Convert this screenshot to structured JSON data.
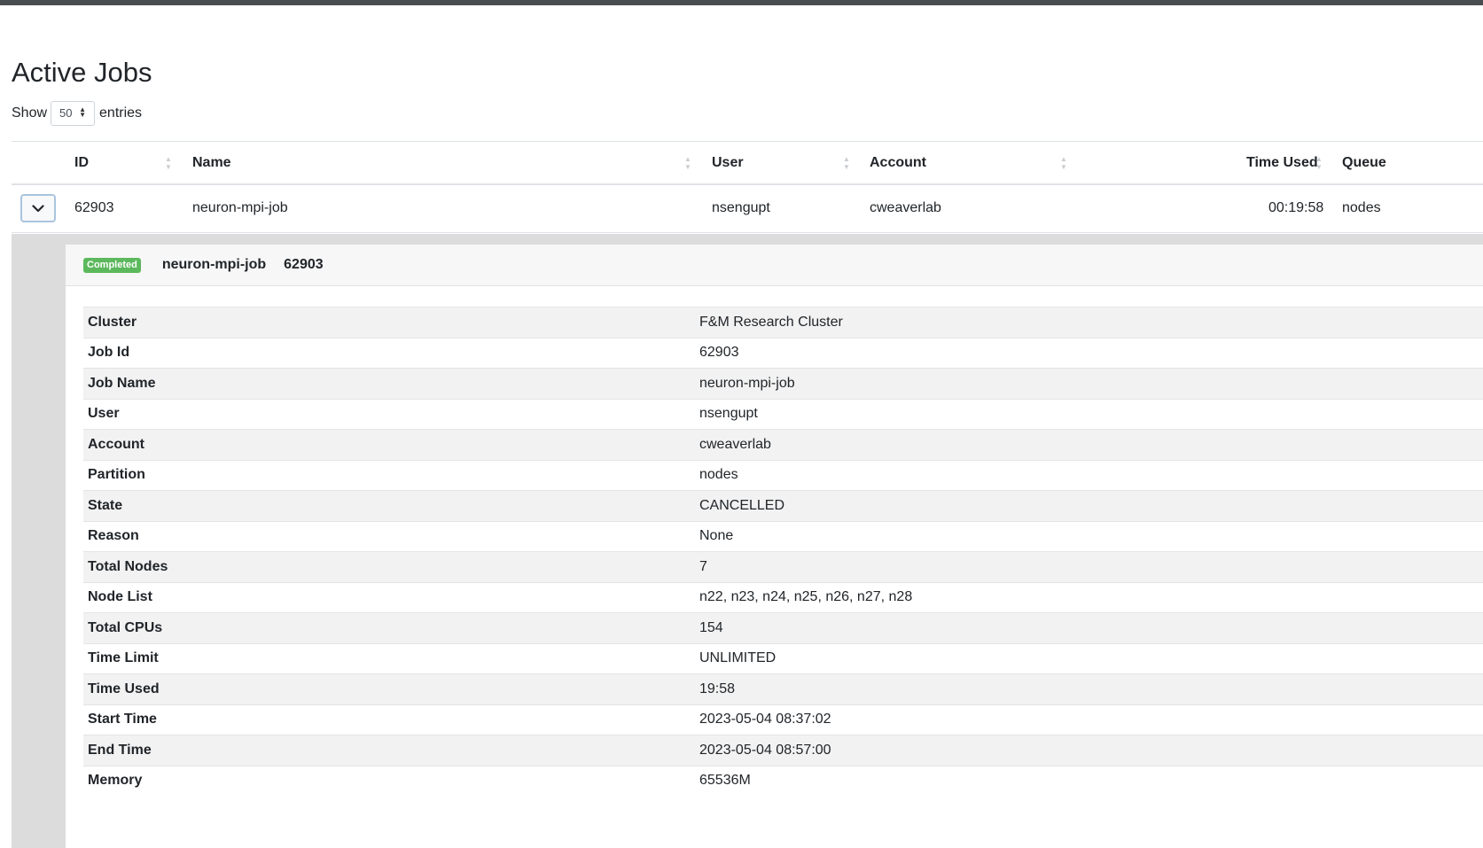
{
  "page": {
    "title": "Active Jobs",
    "length_prefix": "Show",
    "length_value": "50",
    "length_suffix": "entries"
  },
  "table": {
    "headers": {
      "id": "ID",
      "name": "Name",
      "user": "User",
      "account": "Account",
      "time_used": "Time Used",
      "queue": "Queue"
    },
    "row": {
      "id": "62903",
      "name": "neuron-mpi-job",
      "user": "nsengupt",
      "account": "cweaverlab",
      "time_used": "00:19:58",
      "queue": "nodes"
    }
  },
  "detail": {
    "status_badge": "Completed",
    "job_name": "neuron-mpi-job",
    "job_id": "62903",
    "rows": [
      {
        "key": "Cluster",
        "value": "F&M Research Cluster"
      },
      {
        "key": "Job Id",
        "value": "62903"
      },
      {
        "key": "Job Name",
        "value": "neuron-mpi-job"
      },
      {
        "key": "User",
        "value": "nsengupt"
      },
      {
        "key": "Account",
        "value": "cweaverlab"
      },
      {
        "key": "Partition",
        "value": "nodes"
      },
      {
        "key": "State",
        "value": "CANCELLED"
      },
      {
        "key": "Reason",
        "value": "None"
      },
      {
        "key": "Total Nodes",
        "value": "7"
      },
      {
        "key": "Node List",
        "value": "n22, n23, n24, n25, n26, n27, n28"
      },
      {
        "key": "Total CPUs",
        "value": "154"
      },
      {
        "key": "Time Limit",
        "value": "UNLIMITED"
      },
      {
        "key": "Time Used",
        "value": "19:58"
      },
      {
        "key": "Start Time",
        "value": "2023-05-04 08:37:02"
      },
      {
        "key": "End Time",
        "value": "2023-05-04 08:57:00"
      },
      {
        "key": "Memory",
        "value": "65536M"
      }
    ]
  },
  "colors": {
    "badge_completed": "#5cb85c",
    "topbar": "#4a4d50",
    "detail_bg": "#dcdcdc"
  },
  "icons": {
    "toggle": "chevron-down-icon",
    "sort": "sort-icon",
    "select_caret": "caret-updown-icon"
  }
}
